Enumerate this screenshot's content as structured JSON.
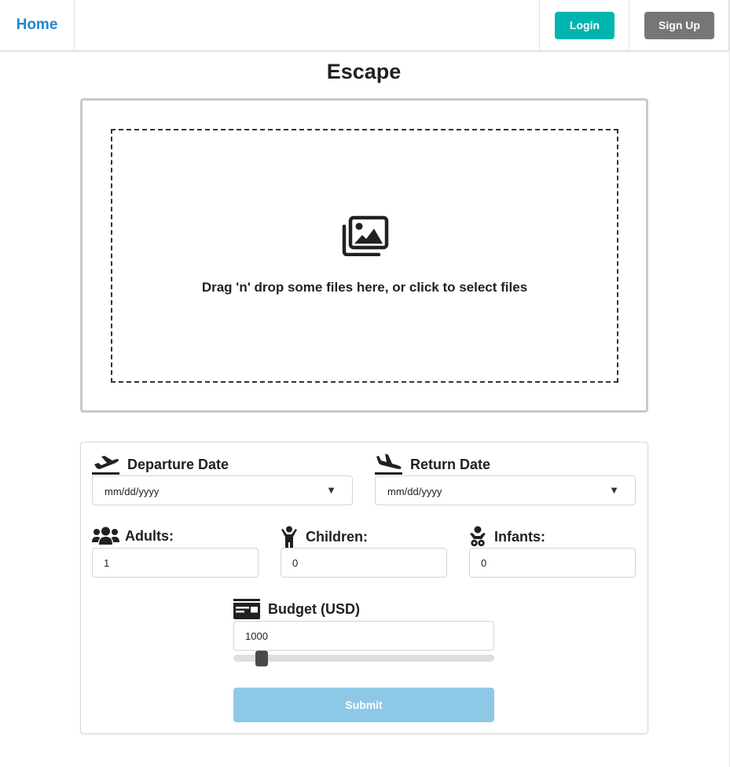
{
  "nav": {
    "home_label": "Home",
    "login_label": "Login",
    "signup_label": "Sign Up"
  },
  "page": {
    "title": "Escape"
  },
  "dropzone": {
    "icon": "images-icon",
    "text": "Drag 'n' drop some files here, or click to select files"
  },
  "form": {
    "departure": {
      "icon": "plane-departure-icon",
      "label": "Departure Date",
      "value": "mm/dd/yyyy",
      "arrow": "▼"
    },
    "return": {
      "icon": "plane-arrival-icon",
      "label": "Return Date",
      "value": "mm/dd/yyyy",
      "arrow": "▼"
    },
    "adults": {
      "icon": "users-icon",
      "label": "Adults:",
      "value": "1"
    },
    "children": {
      "icon": "child-icon",
      "label": "Children:",
      "value": "0"
    },
    "infants": {
      "icon": "baby-icon",
      "label": "Infants:",
      "value": "0"
    },
    "budget": {
      "icon": "money-check-icon",
      "label": "Budget (USD)",
      "value": "1000"
    },
    "submit_label": "Submit"
  },
  "colors": {
    "home_link": "#2185d0",
    "login_button": "#00b5ad",
    "signup_button": "#767676",
    "submit_button": "#8dc9e6",
    "slider_thumb": "#4a4a4a"
  }
}
